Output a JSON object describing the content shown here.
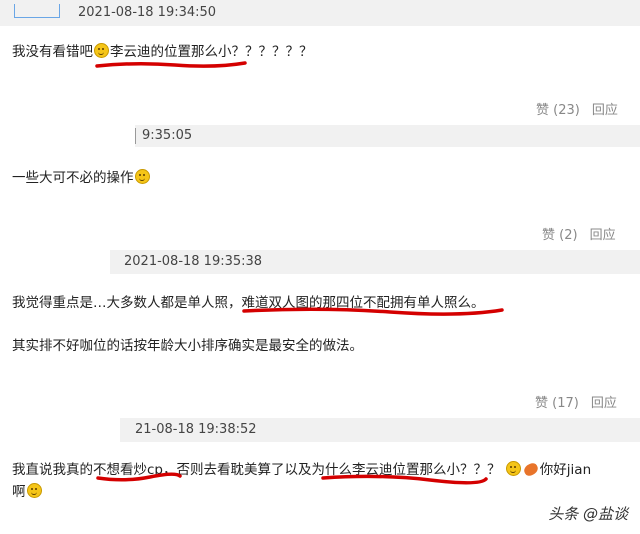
{
  "comments": [
    {
      "timestamp": "2021-08-18 19:34:50",
      "line1_pre": "我没有看错吧",
      "line1_post": "李云迪的位置那么小？？？？？？",
      "likes": "赞 (23)",
      "reply": "回应"
    },
    {
      "timestamp": "9:35:05",
      "line1": "一些大可不必的操作",
      "likes": "赞 (2)",
      "reply": "回应"
    },
    {
      "timestamp": "2021-08-18 19:35:38",
      "line1": "我觉得重点是…大多数人都是单人照，难道双人图的那四位不配拥有单人照么。",
      "line2": "其实排不好咖位的话按年龄大小排序确实是最安全的做法。",
      "likes": "赞 (17)",
      "reply": "回应"
    },
    {
      "timestamp": "21-08-18 19:38:52",
      "line1": "我直说我真的不想看炒cp，否则去看耽美算了以及为什么李云迪位置那么小？？？",
      "line1_tail": "你好jian",
      "line2": "啊",
      "likes": "",
      "reply": ""
    }
  ],
  "watermark": "头条 @盐谈",
  "colors": {
    "band": "#f1f1f1",
    "underline": "#d40000",
    "action": "#888888"
  }
}
